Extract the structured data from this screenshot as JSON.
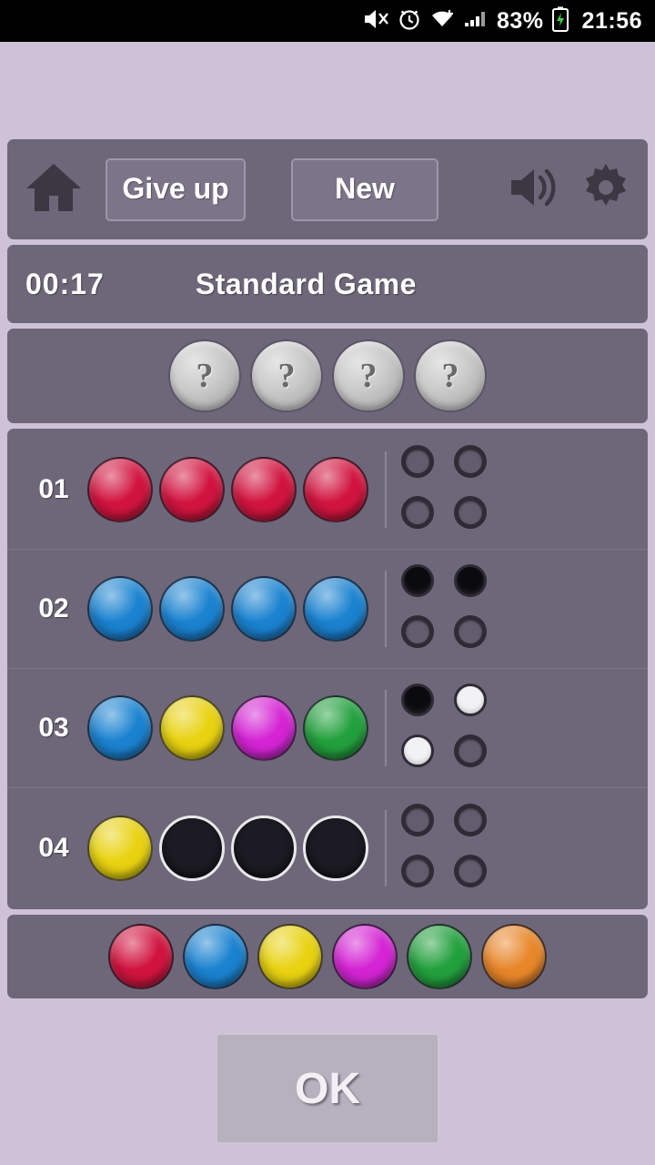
{
  "status_bar": {
    "icons": [
      "mute-icon",
      "alarm-icon",
      "wifi-icon",
      "signal-icon"
    ],
    "battery": "83%",
    "time": "21:56"
  },
  "toolbar": {
    "home_icon": "home-icon",
    "give_up_label": "Give up",
    "new_label": "New",
    "sound_icon": "speaker-icon",
    "settings_icon": "gear-icon"
  },
  "info": {
    "timer": "00:17",
    "mode": "Standard Game"
  },
  "secret": {
    "slots": [
      "?",
      "?",
      "?",
      "?"
    ]
  },
  "colors": {
    "red": "#d1143f",
    "blue": "#1b82d0",
    "yellow": "#e8d211",
    "magenta": "#d424d4",
    "green": "#23a03e",
    "orange": "#e8862a",
    "empty": "#1c1a22"
  },
  "board": {
    "rows": [
      {
        "number": "01",
        "pegs": [
          "red",
          "red",
          "red",
          "red"
        ],
        "feedback": [
          "none",
          "none",
          "none",
          "none"
        ]
      },
      {
        "number": "02",
        "pegs": [
          "blue",
          "blue",
          "blue",
          "blue"
        ],
        "feedback": [
          "black",
          "black",
          "none",
          "none"
        ]
      },
      {
        "number": "03",
        "pegs": [
          "blue",
          "yellow",
          "magenta",
          "green"
        ],
        "feedback": [
          "black",
          "white",
          "white",
          "none"
        ]
      },
      {
        "number": "04",
        "pegs": [
          "yellow",
          "empty",
          "empty",
          "empty"
        ],
        "feedback": [
          "none",
          "none",
          "none",
          "none"
        ]
      }
    ]
  },
  "palette": {
    "pegs": [
      "red",
      "blue",
      "yellow",
      "magenta",
      "green",
      "orange"
    ]
  },
  "submit": {
    "label": "OK"
  }
}
